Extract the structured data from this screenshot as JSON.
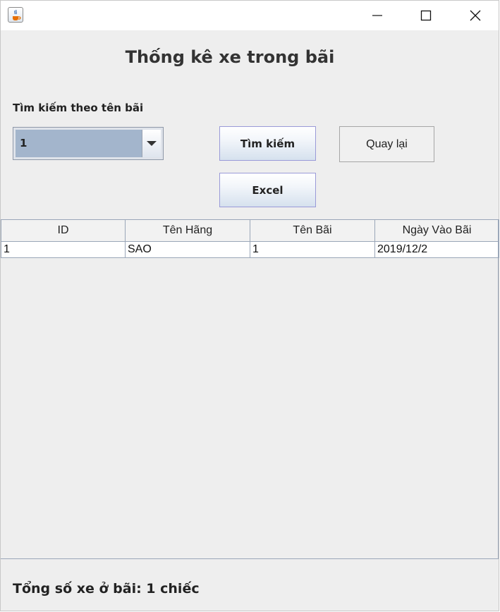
{
  "window": {
    "title": "",
    "controls": {
      "minimize_icon": "minimize-icon",
      "maximize_icon": "maximize-icon",
      "close_icon": "close-icon"
    },
    "app_icon": "java-icon"
  },
  "header": {
    "title": "Thống kê xe trong bãi"
  },
  "search": {
    "label": "Tìm kiếm theo tên bãi",
    "selected_value": "1",
    "search_button": "Tìm kiếm",
    "back_button": "Quay lại",
    "excel_button": "Excel"
  },
  "table": {
    "columns": [
      "ID",
      "Tên Hãng",
      "Tên Bãi",
      "Ngày Vào Bãi"
    ],
    "rows": [
      [
        "1",
        "SAO",
        "1",
        "2019/12/2"
      ]
    ]
  },
  "footer": {
    "total_text": "Tổng số xe ở bãi: 1 chiếc"
  },
  "colors": {
    "background": "#eeeeee",
    "button_border": "#9a9ad8",
    "combo_selected": "#a3b5cc"
  }
}
